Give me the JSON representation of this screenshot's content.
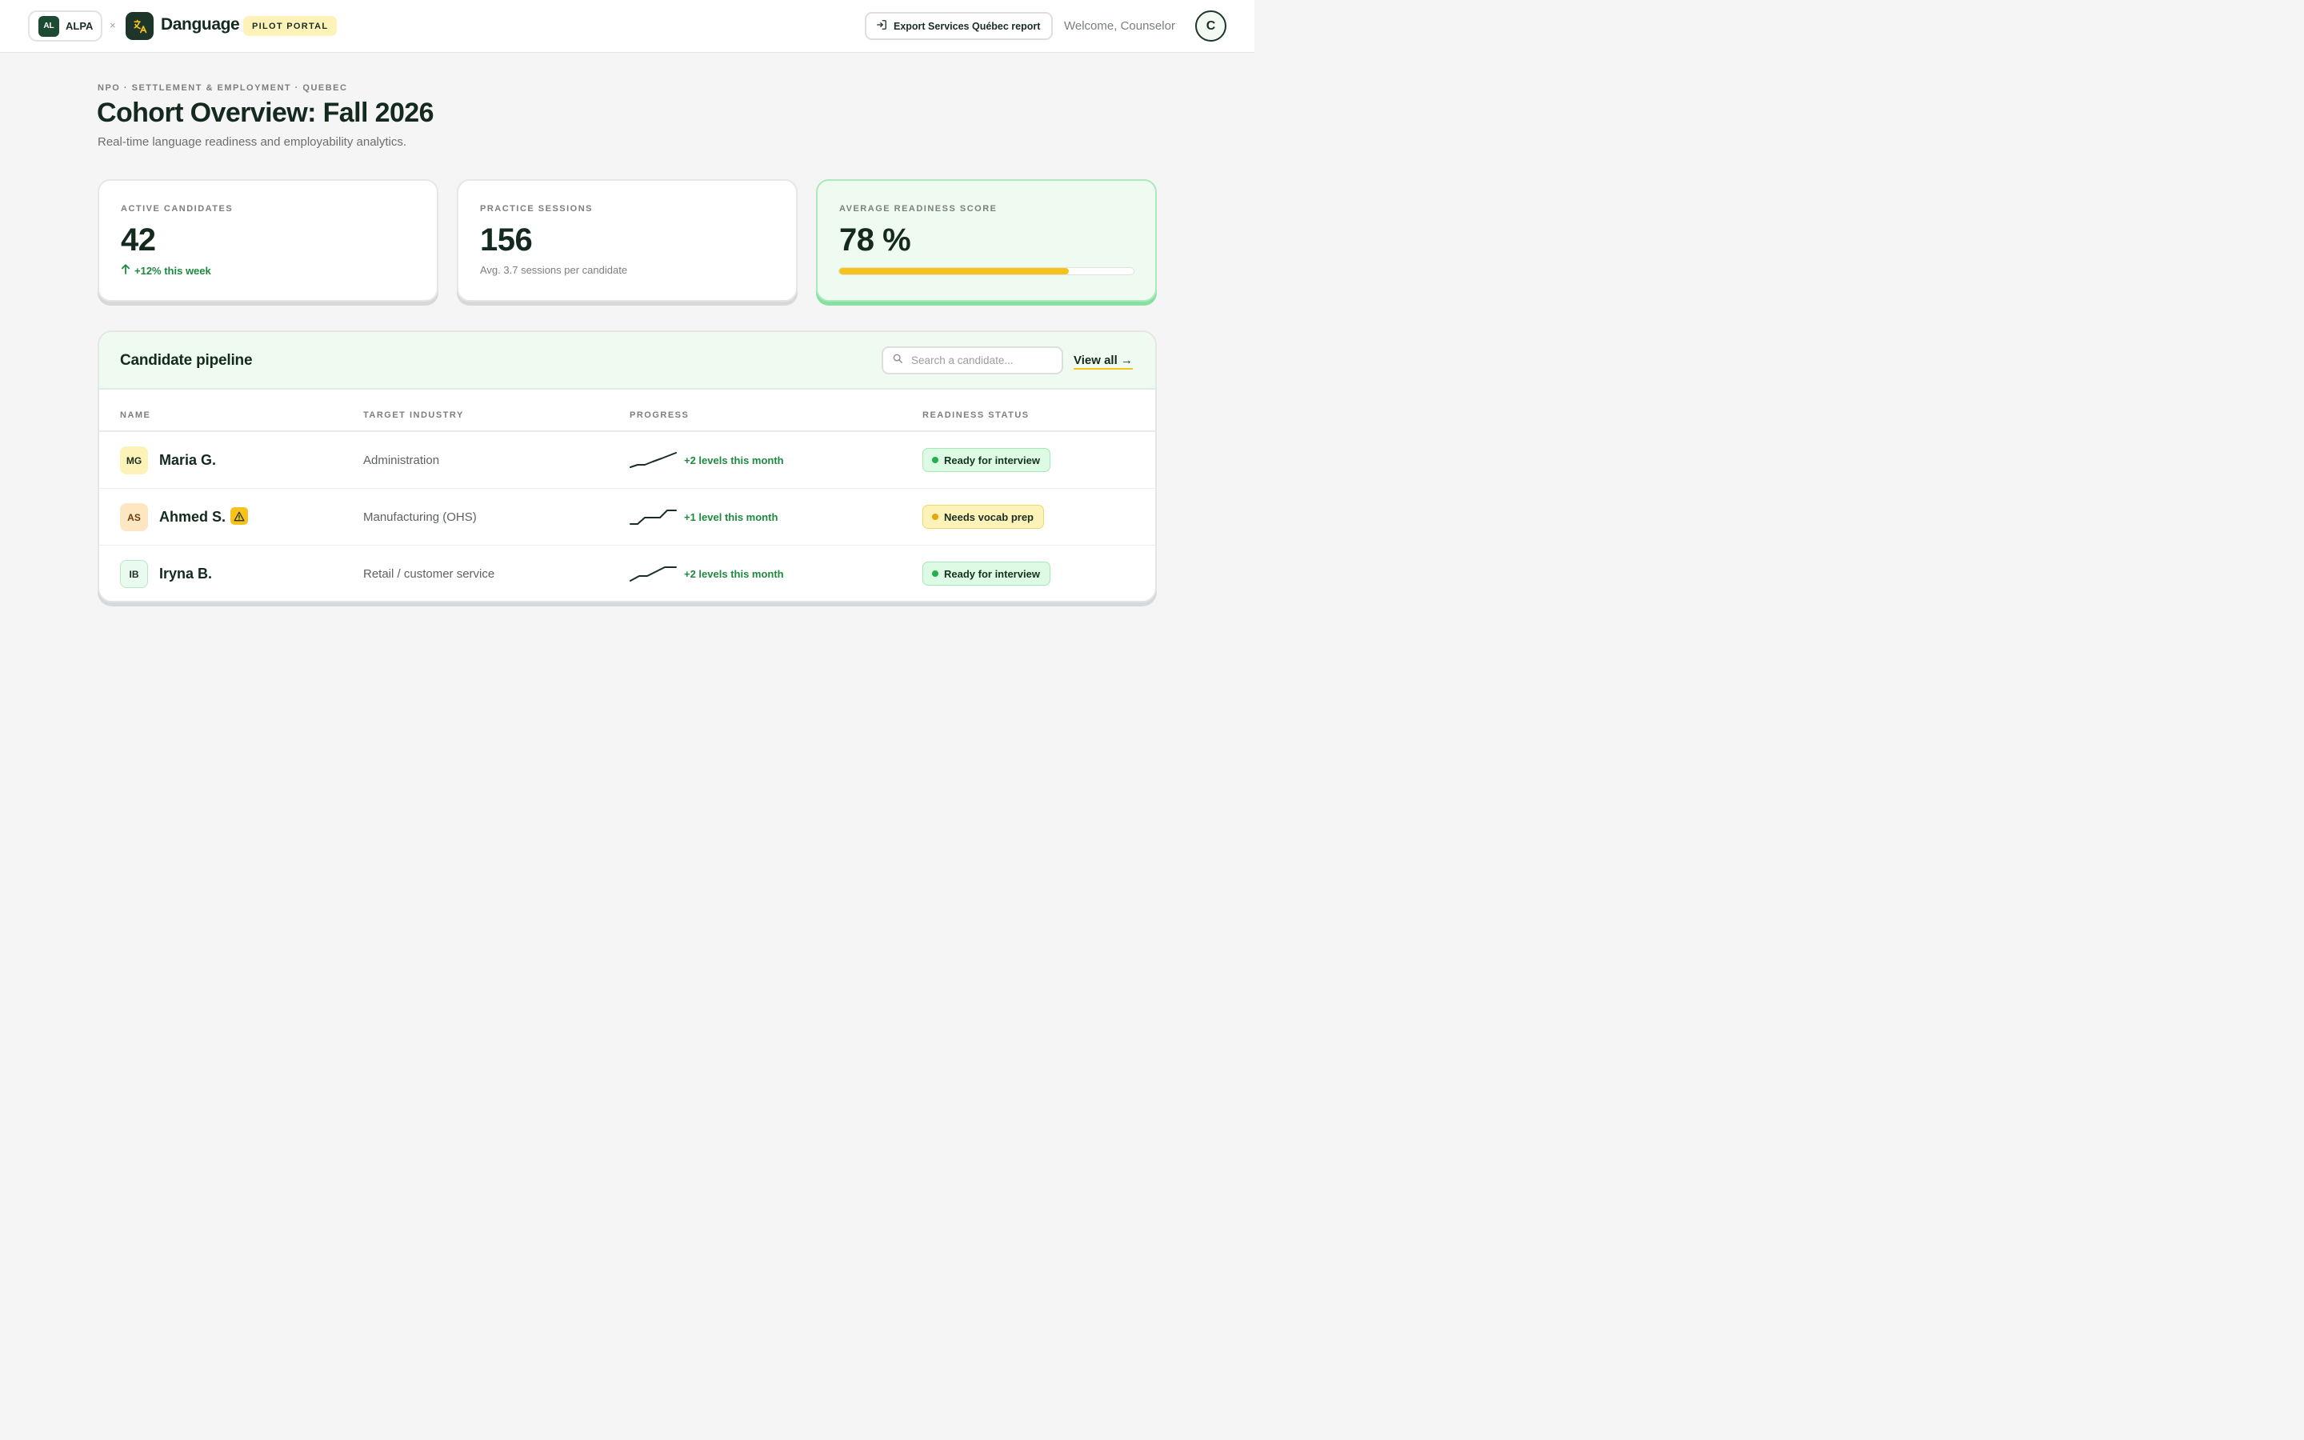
{
  "header": {
    "partner_initials": "AL",
    "partner_name": "ALPA",
    "separator": "×",
    "brand_name": "Danguage",
    "portal_badge": "PILOT PORTAL",
    "export_label": "Export Services Québec report",
    "welcome": "Welcome, Counselor",
    "avatar_initial": "C"
  },
  "page": {
    "eyebrow": "NPO · SETTLEMENT & EMPLOYMENT · QUEBEC",
    "title": "Cohort Overview: Fall 2026",
    "subtitle": "Real-time language readiness and employability analytics."
  },
  "stats": [
    {
      "label": "ACTIVE CANDIDATES",
      "value": "42",
      "note": "+12% this week",
      "trend": "up"
    },
    {
      "label": "PRACTICE SESSIONS",
      "value": "156",
      "note": "Avg. 3.7 sessions per candidate"
    },
    {
      "label": "AVERAGE READINESS SCORE",
      "value": "78 %",
      "progress_percent": 78
    }
  ],
  "pipeline": {
    "title": "Candidate pipeline",
    "search_placeholder": "Search a candidate...",
    "view_all": "View all →",
    "columns": [
      "NAME",
      "TARGET INDUSTRY",
      "PROGRESS",
      "READINESS STATUS"
    ],
    "rows": [
      {
        "initials": "MG",
        "name": "Maria G.",
        "industry": "Administration",
        "progress": "+2 levels this month",
        "status": "Ready for interview",
        "warning": false
      },
      {
        "initials": "AS",
        "name": "Ahmed S.",
        "industry": "Manufacturing (OHS)",
        "progress": "+1 level this month",
        "status": "Needs vocab prep",
        "warning": true
      },
      {
        "initials": "IB",
        "name": "Iryna B.",
        "industry": "Retail / customer service",
        "progress": "+2 levels this month",
        "status": "Ready for interview",
        "warning": false
      }
    ]
  },
  "colors": {
    "brand_dark": "#1e3529",
    "accent_yellow": "#f6c21c",
    "success_green": "#1e8a3f",
    "ready_bg": "#dcfae4",
    "prep_bg": "#fdf3b8",
    "ready_dot": "#22b14c",
    "prep_dot": "#e3a808"
  },
  "icons": {
    "brand_logo": "translate-icon",
    "export": "export-icon",
    "search": "search-icon",
    "trend": "arrow-up-icon",
    "warning": "warning-icon"
  }
}
